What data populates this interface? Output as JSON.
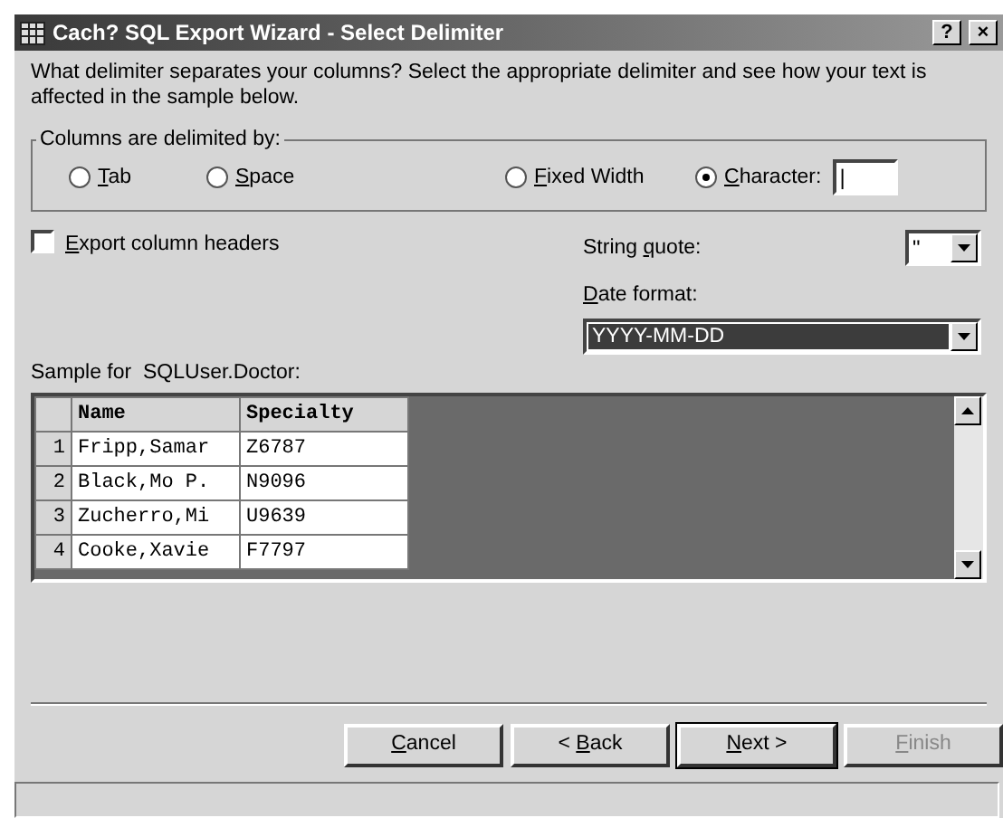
{
  "window": {
    "title": "Cach? SQL Export Wizard - Select Delimiter",
    "title_buttons": [
      "?",
      "×"
    ]
  },
  "intro": "What delimiter separates your columns? Select the appropriate delimiter and see how your text is affected in the sample below.",
  "delimiter_group": {
    "legend": "Columns are delimited by:",
    "options": [
      {
        "label": {
          "key": "T",
          "rest": "ab"
        },
        "selected": false
      },
      {
        "label": {
          "key": "S",
          "rest": "pace"
        },
        "selected": false
      },
      {
        "label": {
          "key": "F",
          "rest": "ixed Width"
        },
        "selected": false
      },
      {
        "label": {
          "key": "C",
          "rest": "haracter:"
        },
        "selected": true
      }
    ],
    "character_value": "|"
  },
  "export_headers": {
    "label": {
      "key": "E",
      "rest": "xport column headers"
    },
    "checked": false
  },
  "string_quote": {
    "label": {
      "before": "String ",
      "key": "q",
      "rest": "uote:"
    },
    "value": "\""
  },
  "date_format": {
    "label": {
      "key": "D",
      "rest": "ate format:"
    },
    "value": "YYYY-MM-DD"
  },
  "sample": {
    "label": "Sample for  SQLUser.Doctor:",
    "columns": [
      "Name",
      "Specialty"
    ],
    "rows": [
      {
        "number": "1",
        "cells": [
          "Fripp,Samar",
          "Z6787"
        ]
      },
      {
        "number": "2",
        "cells": [
          "Black,Mo P.",
          "N9096"
        ]
      },
      {
        "number": "3",
        "cells": [
          "Zucherro,Mi",
          "U9639"
        ]
      },
      {
        "number": "4",
        "cells": [
          "Cooke,Xavie",
          "F7797"
        ]
      }
    ]
  },
  "buttons": [
    {
      "label": {
        "key": "C",
        "rest": "ancel"
      },
      "disabled": false,
      "default": false
    },
    {
      "label": {
        "before": "< ",
        "key": "B",
        "rest": "ack"
      },
      "disabled": false,
      "default": false
    },
    {
      "label": {
        "key": "N",
        "rest": "ext >"
      },
      "disabled": false,
      "default": true
    },
    {
      "label": {
        "key": "F",
        "rest": "inish"
      },
      "disabled": true,
      "default": false
    }
  ]
}
